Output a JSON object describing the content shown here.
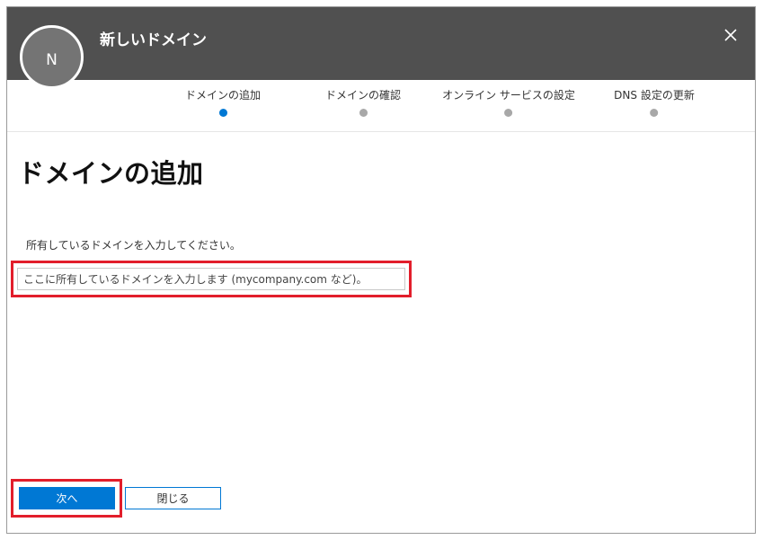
{
  "dialog": {
    "title": "新しいドメイン",
    "avatar_initial": "N",
    "close_icon": "close-icon"
  },
  "steps": [
    {
      "label": "ドメインの追加",
      "active": true
    },
    {
      "label": "ドメインの確認",
      "active": false
    },
    {
      "label": "オンライン サービスの設定",
      "active": false
    },
    {
      "label": "DNS 設定の更新",
      "active": false
    }
  ],
  "main": {
    "heading": "ドメインの追加",
    "instruction": "所有しているドメインを入力してください。",
    "domain_input": {
      "value": "",
      "placeholder": "ここに所有しているドメインを入力します (mycompany.com など)。"
    }
  },
  "footer": {
    "next_label": "次へ",
    "close_label": "閉じる"
  },
  "colors": {
    "header_bg": "#505050",
    "accent": "#0078d4",
    "highlight": "#e21e2b",
    "inactive_dot": "#a8a8a8"
  }
}
